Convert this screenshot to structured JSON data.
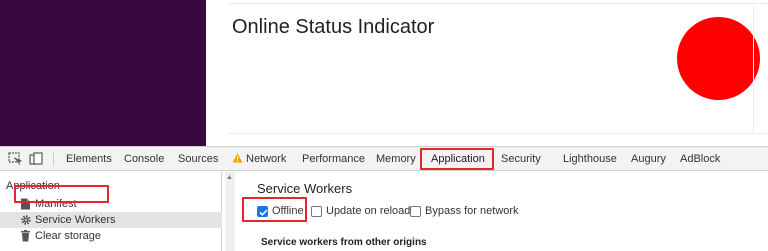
{
  "page": {
    "title": "Online Status Indicator",
    "status_color": "#ff0000"
  },
  "devtools": {
    "tabs": [
      {
        "label": "Elements"
      },
      {
        "label": "Console"
      },
      {
        "label": "Sources"
      },
      {
        "label": "Network",
        "warning": true
      },
      {
        "label": "Performance"
      },
      {
        "label": "Memory"
      },
      {
        "label": "Application",
        "active": true
      },
      {
        "label": "Security"
      },
      {
        "label": "Lighthouse"
      },
      {
        "label": "Augury"
      },
      {
        "label": "AdBlock"
      }
    ],
    "sidebar": {
      "heading": "Application",
      "items": [
        {
          "label": "Manifest",
          "icon": "document-icon"
        },
        {
          "label": "Service Workers",
          "icon": "gear-icon",
          "selected": true
        },
        {
          "label": "Clear storage",
          "icon": "trash-icon"
        }
      ]
    },
    "main": {
      "title": "Service Workers",
      "checkboxes": [
        {
          "label": "Offline",
          "checked": true
        },
        {
          "label": "Update on reload",
          "checked": false
        },
        {
          "label": "Bypass for network",
          "checked": false
        }
      ],
      "section_heading": "Service workers from other origins"
    },
    "colors": {
      "highlight": "#e8252f",
      "accent": "#1a73e8",
      "page_left_panel": "#3a0841"
    }
  }
}
